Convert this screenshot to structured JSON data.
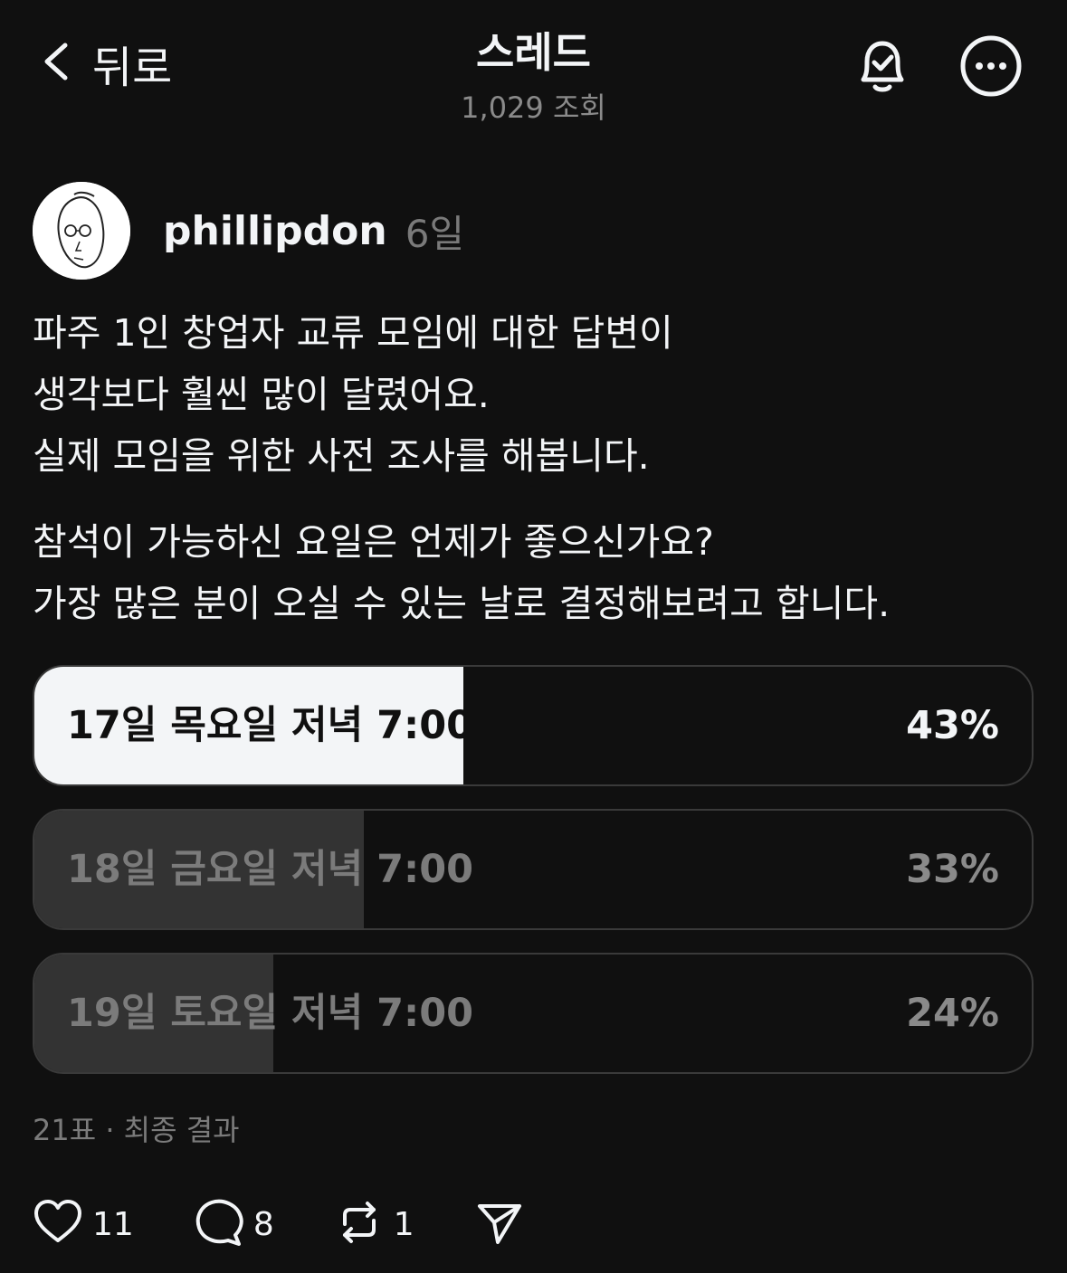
{
  "header": {
    "back_label": "뒤로",
    "title": "스레드",
    "subtitle": "1,029 조회"
  },
  "post": {
    "username": "phillipdon",
    "time": "6일",
    "paragraph1": "파주 1인 창업자 교류 모임에 대한 답변이\n생각보다 훨씬 많이 달렸어요.\n실제 모임을 위한 사전 조사를 해봅니다.",
    "paragraph2": "참석이 가능하신 요일은 언제가 좋으신가요?\n가장 많은 분이 오실 수 있는 날로 결정해보려고 합니다."
  },
  "poll": {
    "options": [
      {
        "label": "17일 목요일 저녁 7:00",
        "percent_text": "43%",
        "percent": 43
      },
      {
        "label": "18일 금요일 저녁 7:00",
        "percent_text": "33%",
        "percent": 33
      },
      {
        "label": "19일 토요일 저녁 7:00",
        "percent_text": "24%",
        "percent": 24
      }
    ],
    "meta": "21표 · 최종 결과"
  },
  "actions": {
    "likes": "11",
    "replies": "8",
    "reposts": "1"
  },
  "icons": {
    "back": "chevron-left-icon",
    "bell": "bell-check-icon",
    "more": "more-horizontal-icon",
    "like": "heart-icon",
    "reply": "comment-icon",
    "repost": "repost-icon",
    "share": "send-icon"
  },
  "colors": {
    "background": "#101010",
    "text": "#f3f5f7",
    "muted": "#7b7b7b",
    "poll_winner_fill": "#f3f5f7",
    "poll_other_fill": "#333333"
  }
}
